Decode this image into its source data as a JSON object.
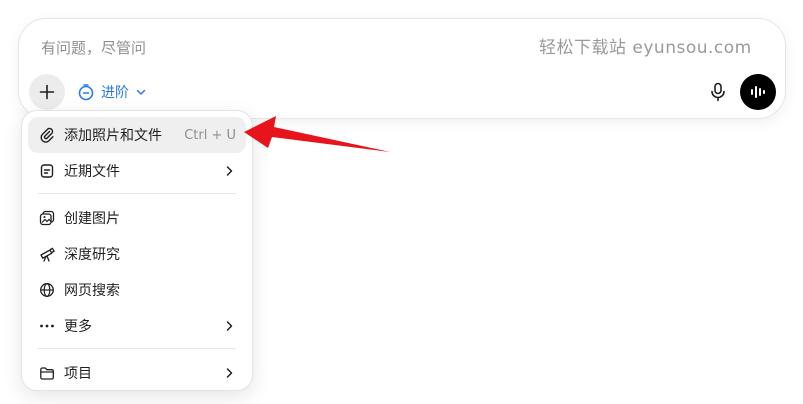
{
  "composer": {
    "placeholder": "有问题，尽管问",
    "watermark": "轻松下载站 eyunsou.com",
    "mode_label": "进阶"
  },
  "menu": {
    "items": [
      {
        "label": "添加照片和文件",
        "shortcut": "Ctrl + U",
        "icon": "paperclip-icon"
      },
      {
        "label": "近期文件",
        "icon": "document-icon",
        "submenu": true
      },
      {
        "label": "创建图片",
        "icon": "image-create-icon"
      },
      {
        "label": "深度研究",
        "icon": "telescope-icon"
      },
      {
        "label": "网页搜索",
        "icon": "globe-icon"
      },
      {
        "label": "更多",
        "icon": "more-dots-icon",
        "submenu": true
      },
      {
        "label": "项目",
        "icon": "folder-icon",
        "submenu": true
      }
    ]
  },
  "colors": {
    "accent": "#2a7be4",
    "arrow": "#e8141c",
    "menu_hover": "#efefef"
  }
}
